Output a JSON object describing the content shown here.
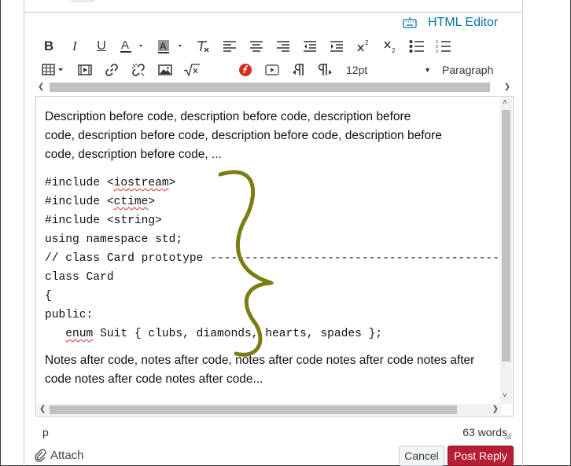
{
  "editor_header": {
    "html_editor_label": "HTML Editor"
  },
  "toolbar": {
    "font_size": "12pt",
    "block_format": "Paragraph"
  },
  "content": {
    "description_lines": [
      "Description before code, description before code, description before",
      "code, description before code, description before code, description before",
      "code, description before code, ..."
    ],
    "code_lines": [
      "#include <iostream>",
      "#include <ctime>",
      "#include <string>",
      "using namespace std;",
      "// class Card prototype --------------------------------------------",
      "class Card",
      "{",
      "public:",
      "   enum Suit { clubs, diamonds, hearts, spades };"
    ],
    "notes_lines": [
      "Notes after code, notes after code, notes after code notes after code notes after",
      "code notes after code notes after code..."
    ]
  },
  "status_bar": {
    "path": "p",
    "word_count": "63 words"
  },
  "footer": {
    "attach_label": "Attach",
    "cancel_label": "Cancel",
    "post_label": "Post Reply"
  },
  "colors": {
    "link": "#0770a3",
    "post_button": "#b51d32",
    "annotation_brace": "#7a7d12"
  }
}
